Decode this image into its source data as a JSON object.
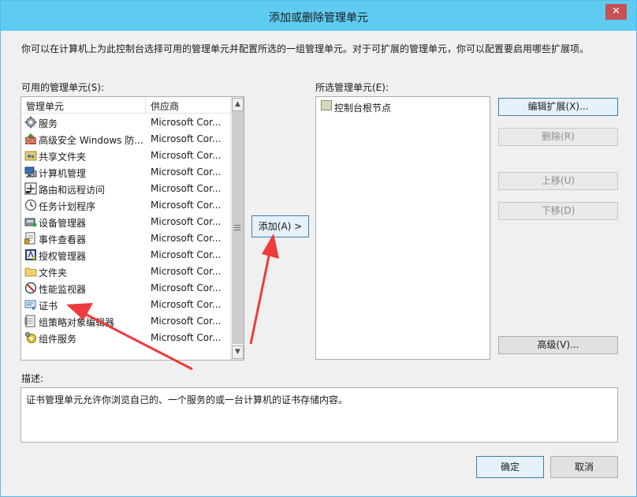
{
  "window": {
    "title": "添加或删除管理单元",
    "close_glyph": "✕"
  },
  "intro_text": "你可以在计算机上为此控制台选择可用的管理单元并配置所选的一组管理单元。对于可扩展的管理单元，你可以配置要启用哪些扩展项。",
  "available": {
    "label": "可用的管理单元(S):",
    "columns": {
      "name": "管理单元",
      "vendor": "供应商"
    },
    "items": [
      {
        "name": "服务",
        "vendor": "Microsoft Cor...",
        "icon": "gear-icon"
      },
      {
        "name": "高级安全 Windows 防...",
        "vendor": "Microsoft Cor...",
        "icon": "firewall-icon"
      },
      {
        "name": "共享文件夹",
        "vendor": "Microsoft Cor...",
        "icon": "shared-folder-icon"
      },
      {
        "name": "计算机管理",
        "vendor": "Microsoft Cor...",
        "icon": "computer-management-icon"
      },
      {
        "name": "路由和远程访问",
        "vendor": "Microsoft Cor...",
        "icon": "routing-icon"
      },
      {
        "name": "任务计划程序",
        "vendor": "Microsoft Cor...",
        "icon": "clock-icon"
      },
      {
        "name": "设备管理器",
        "vendor": "Microsoft Cor...",
        "icon": "device-manager-icon"
      },
      {
        "name": "事件查看器",
        "vendor": "Microsoft Cor...",
        "icon": "event-viewer-icon"
      },
      {
        "name": "授权管理器",
        "vendor": "Microsoft Cor...",
        "icon": "authorization-icon"
      },
      {
        "name": "文件夹",
        "vendor": "Microsoft Cor...",
        "icon": "folder-icon"
      },
      {
        "name": "性能监视器",
        "vendor": "Microsoft Cor...",
        "icon": "performance-icon"
      },
      {
        "name": "证书",
        "vendor": "Microsoft Cor...",
        "icon": "certificate-icon"
      },
      {
        "name": "组策略对象编辑器",
        "vendor": "Microsoft Cor...",
        "icon": "group-policy-icon"
      },
      {
        "name": "组件服务",
        "vendor": "Microsoft Cor...",
        "icon": "component-services-icon"
      }
    ]
  },
  "add_button": "添加(A) >",
  "selected": {
    "label": "所选管理单元(E):",
    "items": [
      {
        "name": "控制台根节点",
        "icon": "folder-icon"
      }
    ]
  },
  "side_buttons": {
    "edit_ext": "编辑扩展(X)...",
    "remove": "删除(R)",
    "move_up": "上移(U)",
    "move_down": "下移(D)",
    "advanced": "高级(V)..."
  },
  "description": {
    "label": "描述:",
    "text": "证书管理单元允许你浏览自己的、一个服务的或一台计算机的证书存储内容。"
  },
  "footer": {
    "ok": "确定",
    "cancel": "取消"
  },
  "colors": {
    "titlebar": "#5ecbf1",
    "annotation_arrow": "#ee3b3b"
  }
}
